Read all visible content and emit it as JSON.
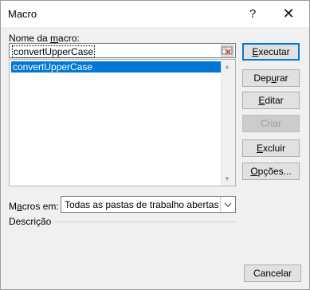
{
  "window": {
    "title": "Macro",
    "help_symbol": "?",
    "close_symbol": "✕"
  },
  "labels": {
    "name_prefix": "Nome da ",
    "name_underline": "m",
    "name_suffix": "acro:",
    "macros_in_prefix": "M",
    "macros_in_underline": "a",
    "macros_in_suffix": "cros em:",
    "description": "Descrição"
  },
  "macro_name_input": {
    "value": "convertUpperCase"
  },
  "macro_list": {
    "items": [
      "convertUpperCase"
    ],
    "selected_index": 0
  },
  "macros_in_select": {
    "value": "Todas as pastas de trabalho abertas"
  },
  "buttons": {
    "run": {
      "prefix": "",
      "underline": "E",
      "suffix": "xecutar"
    },
    "step_into": {
      "prefix": "Dep",
      "underline": "u",
      "suffix": "rar"
    },
    "edit": {
      "prefix": "",
      "underline": "E",
      "suffix": "ditar"
    },
    "create": {
      "label": "Criar",
      "enabled": false
    },
    "delete": {
      "prefix": "",
      "underline": "E",
      "suffix": "xcluir"
    },
    "options": {
      "prefix": "",
      "underline": "O",
      "suffix": "pções..."
    },
    "cancel": {
      "label": "Cancelar"
    }
  },
  "icons": [
    "help-icon",
    "close-icon",
    "collapse-dialog-icon",
    "scroll-up-icon",
    "scroll-down-icon",
    "chevron-down-icon"
  ],
  "colors": {
    "selection": "#0078d7",
    "default_button_border": "#0078d7"
  }
}
